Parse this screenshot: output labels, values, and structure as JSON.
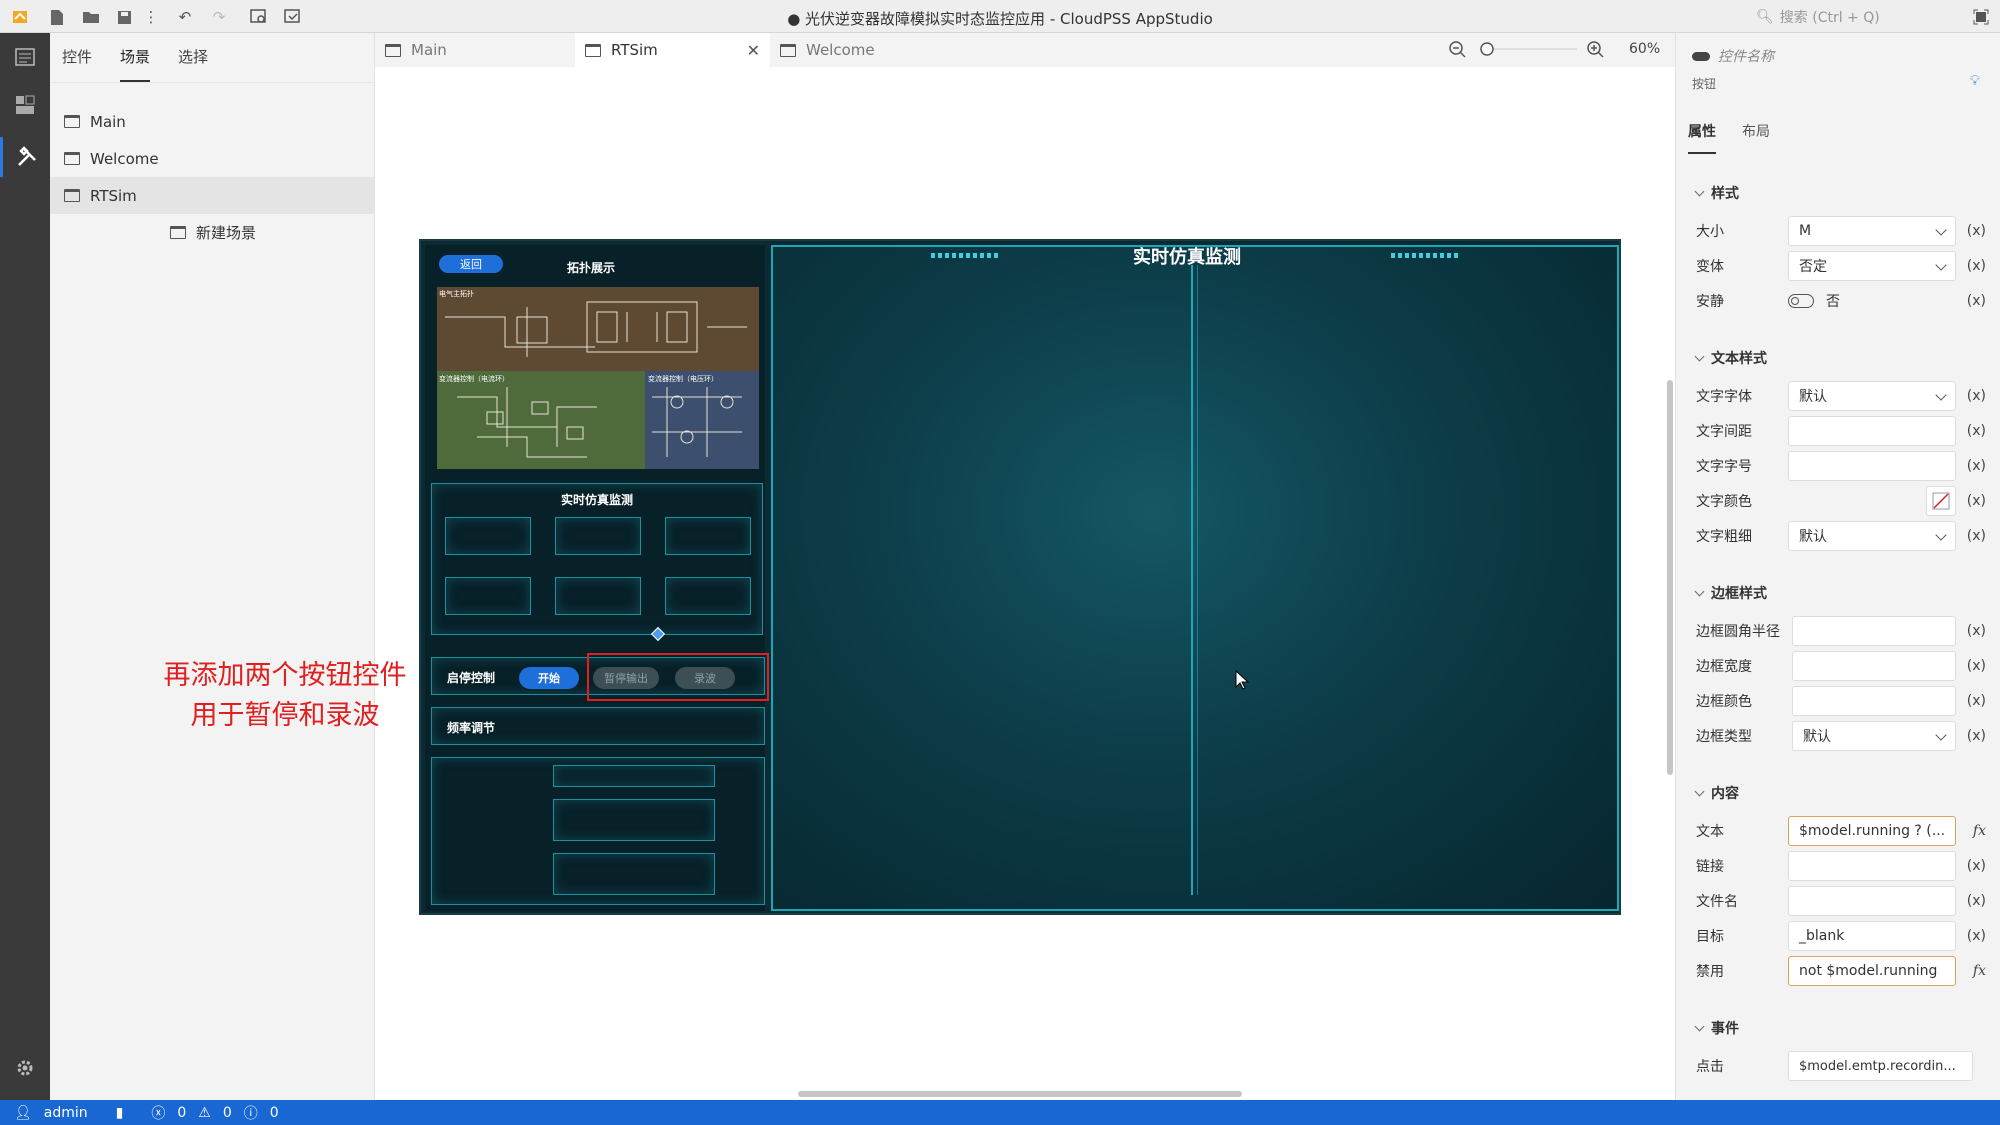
{
  "window": {
    "title": "● 光伏逆变器故障模拟实时态监控应用 - CloudPSS AppStudio",
    "search_placeholder": "搜索 (Ctrl + Q)"
  },
  "sidebar": {
    "tabs": [
      {
        "label": "控件"
      },
      {
        "label": "场景"
      },
      {
        "label": "选择"
      }
    ],
    "items": [
      {
        "label": "Main"
      },
      {
        "label": "Welcome"
      },
      {
        "label": "RTSim"
      }
    ],
    "new_scene": "新建场景"
  },
  "editor_tabs": [
    {
      "label": "Main"
    },
    {
      "label": "RTSim"
    },
    {
      "label": "Welcome"
    }
  ],
  "zoom": {
    "value": "60%"
  },
  "stage": {
    "back_btn": "返回",
    "topology_title": "拓扑展示",
    "schematic_labels": [
      "电气主拓扑",
      "变流器控制（电流环）",
      "变流器控制（电压环）"
    ],
    "sub_monitor_title": "实时仿真监测",
    "start_stop_label": "启停控制",
    "start_btn": "开始",
    "pause_btn": "暂停输出",
    "record_btn": "录波",
    "freq_label": "频率调节",
    "main_title": "实时仿真监测"
  },
  "annotation": {
    "line1": "再添加两个按钮控件",
    "line2": "用于暂停和录波"
  },
  "props": {
    "name_placeholder": "控件名称",
    "type": "按钮",
    "tabs": [
      "属性",
      "布局"
    ],
    "style_section": "样式",
    "size_label": "大小",
    "size_value": "M",
    "variant_label": "变体",
    "variant_value": "否定",
    "quiet_label": "安静",
    "quiet_value": "否",
    "text_style_section": "文本样式",
    "font_label": "文字字体",
    "font_value": "默认",
    "spacing_label": "文字间距",
    "fontsize_label": "文字字号",
    "color_label": "文字颜色",
    "weight_label": "文字粗细",
    "weight_value": "默认",
    "border_section": "边框样式",
    "radius_label": "边框圆角半径",
    "bwidth_label": "边框宽度",
    "bcolor_label": "边框颜色",
    "btype_label": "边框类型",
    "btype_value": "默认",
    "content_section": "内容",
    "text_label": "文本",
    "text_value": "$model.running ? (...",
    "link_label": "链接",
    "filename_label": "文件名",
    "target_label": "目标",
    "target_value": "_blank",
    "disabled_label": "禁用",
    "disabled_value": "not $model.running",
    "event_section": "事件",
    "click_label": "点击",
    "click_value": "$model.emtp.recordin...",
    "x_marker": "(x)"
  },
  "status": {
    "user": "admin",
    "errors": "0",
    "warnings": "0",
    "infos": "0"
  }
}
